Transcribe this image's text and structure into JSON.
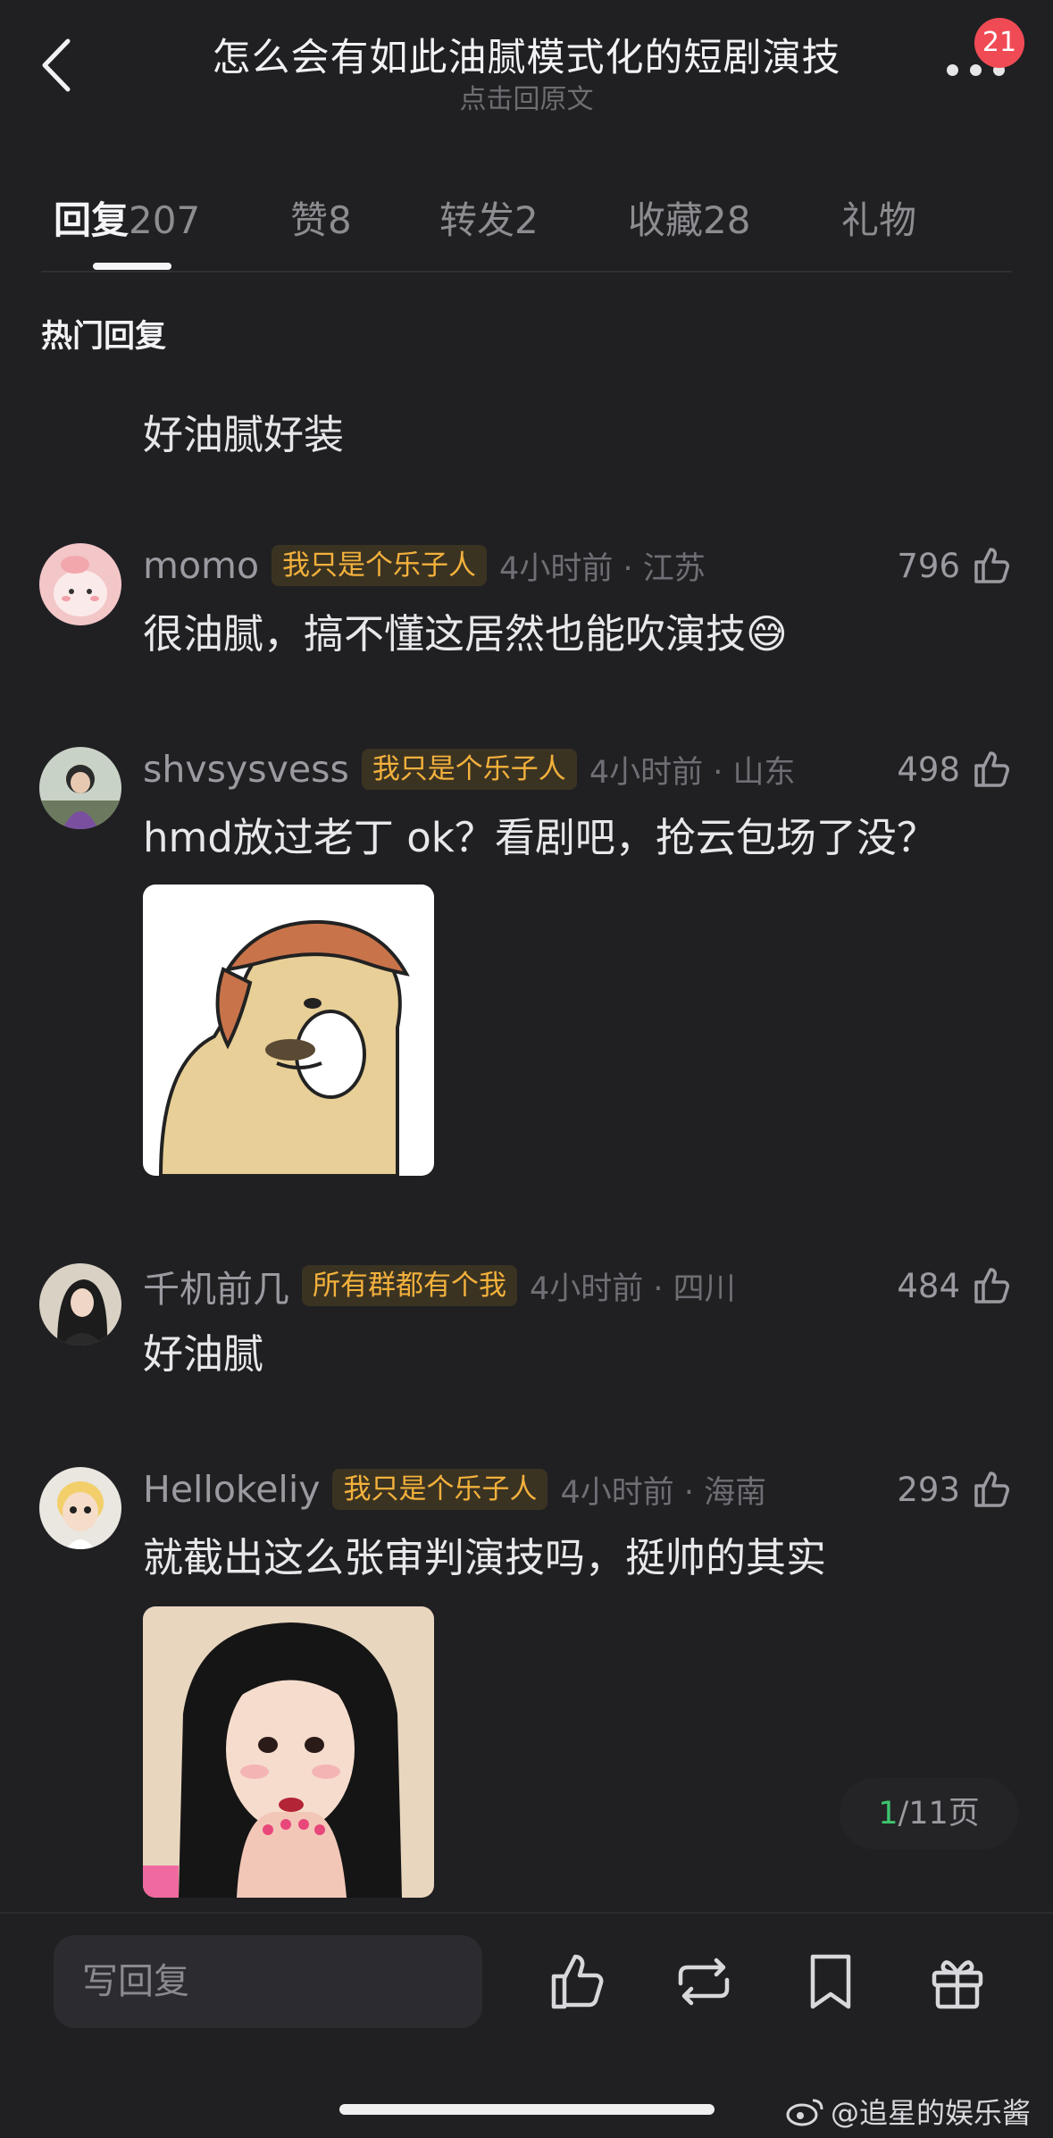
{
  "header": {
    "title": "怎么会有如此油腻模式化的短剧演技",
    "subtitle": "点击回原文",
    "notification_count": "21",
    "back_icon": "chevron-left-icon",
    "more_icon": "more-dots-icon"
  },
  "tabs": [
    {
      "label": "回复",
      "count": "207"
    },
    {
      "label": "赞",
      "count": "8"
    },
    {
      "label": "转发",
      "count": "2"
    },
    {
      "label": "收藏",
      "count": "28"
    },
    {
      "label": "礼物",
      "count": ""
    }
  ],
  "section_title": "热门回复",
  "pinned_text": "好油腻好装",
  "comments": [
    {
      "username": "momo",
      "tag": "我只是个乐子人",
      "time": "4小时前 · 江苏",
      "likes": "796",
      "text": "很油腻，搞不懂这居然也能吹演技😅",
      "has_image": false
    },
    {
      "username": "shvsysvess",
      "tag": "我只是个乐子人",
      "time": "4小时前 · 山东",
      "likes": "498",
      "text": "hmd放过老丁 ok？看剧吧，抢云包场了没？",
      "has_image": true
    },
    {
      "username": "千机前几",
      "tag": "所有群都有个我",
      "time": "4小时前 · 四川",
      "likes": "484",
      "text": "好油腻",
      "has_image": false
    },
    {
      "username": "Hellokeliy",
      "tag": "我只是个乐子人",
      "time": "4小时前 · 海南",
      "likes": "293",
      "text": "就截出这么张审判演技吗，挺帅的其实",
      "has_image": true
    }
  ],
  "pager": {
    "current": "1",
    "total": "/11页"
  },
  "bottom_bar": {
    "reply_placeholder": "写回复",
    "icons": [
      "thumbs-up-icon",
      "repost-icon",
      "bookmark-icon",
      "gift-icon"
    ]
  },
  "watermark": "@追星的娱乐酱",
  "colors": {
    "background": "#202023",
    "tag_text": "#f3b13c",
    "tag_bg": "#3b3322",
    "badge": "#f04b55",
    "pager_current": "#3ec46d"
  }
}
